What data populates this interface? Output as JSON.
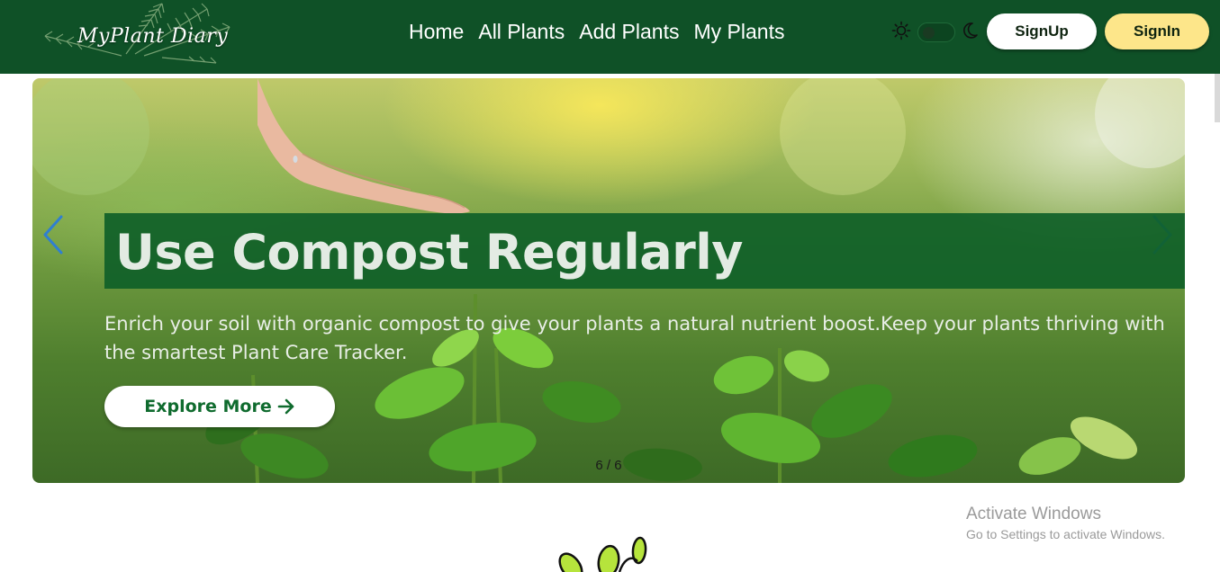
{
  "brand": {
    "name": "MyPlant Diary"
  },
  "nav": {
    "links": [
      "Home",
      "All Plants",
      "Add Plants",
      "My Plants"
    ]
  },
  "theme_toggle": {
    "light_icon": "sun-icon",
    "dark_icon": "moon-icon"
  },
  "auth": {
    "signup_label": "SignUp",
    "signin_label": "SignIn"
  },
  "hero": {
    "title": "Use Compost Regularly",
    "description": "Enrich your soil with organic compost to give your plants a natural nutrient boost.Keep your plants thriving with the smartest Plant Care Tracker.",
    "button_label": "Explore More",
    "button_icon": "arrow-right-icon",
    "pagination": "6 / 6",
    "prev_icon": "chevron-left-icon",
    "next_icon": "chevron-right-icon"
  },
  "watermark": {
    "title": "Activate Windows",
    "subtitle": "Go to Settings to activate Windows."
  },
  "colors": {
    "navbar": "#0f5127",
    "signin_bg": "#fde68a",
    "title_band": "#0f5f28",
    "accent_green": "#0f6b2e",
    "arrow_blue": "#2f7fd1"
  }
}
